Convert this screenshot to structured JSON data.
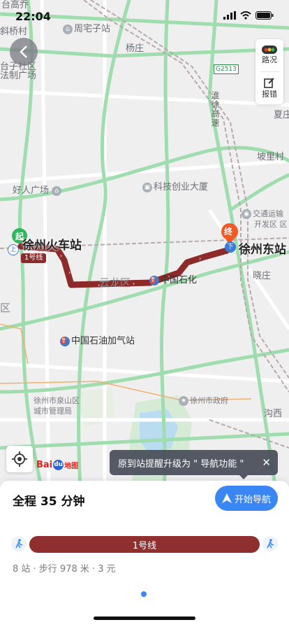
{
  "status_bar": {
    "time": "22:04"
  },
  "map": {
    "labels": {
      "taiqiao": "台高乔",
      "xieqiao": "斜桥村",
      "zhouzhai": "周宅子站",
      "yangzhuang": "杨庄",
      "taizi": "台子社区",
      "fazhi": "法制广场",
      "huaihuai": "淮徐高速",
      "g2513": "G2513",
      "xiazhuang": "夏庄",
      "pobeicun": "坡里村",
      "haoren": "好人广场",
      "keji": "科技创业大厦",
      "jiaotong": "交通运输",
      "kaifa": "开发区 区",
      "xiaozhuang": "晓庄",
      "yunlong": "云龙区",
      "zhongshihua": "中国石化",
      "qu": "区",
      "jiaqizhan": "中国石油加气站",
      "quanshan": "徐州市泉山区",
      "chengshi": "城市管理局",
      "zhengfu": "徐州市政府",
      "goubi": "沟西",
      "huoche": "徐州火车站",
      "dongzhan": "徐州东站",
      "line_tag": "1号线",
      "start": "起",
      "end": "终",
      "shang": "上",
      "xia": "下"
    }
  },
  "tools": {
    "traffic": "路况",
    "report": "报错"
  },
  "logo": {
    "text": "Bai",
    "paw": "du",
    "map": "地图"
  },
  "tip": {
    "text": "原到站提醒升级为 \" 导航功能 \"",
    "close": "✕"
  },
  "panel": {
    "duration": "全程 35 分钟",
    "nav_button": "开始导航",
    "line": "1号线",
    "summary": "8 站 · 步行 978 米 · 3 元"
  }
}
